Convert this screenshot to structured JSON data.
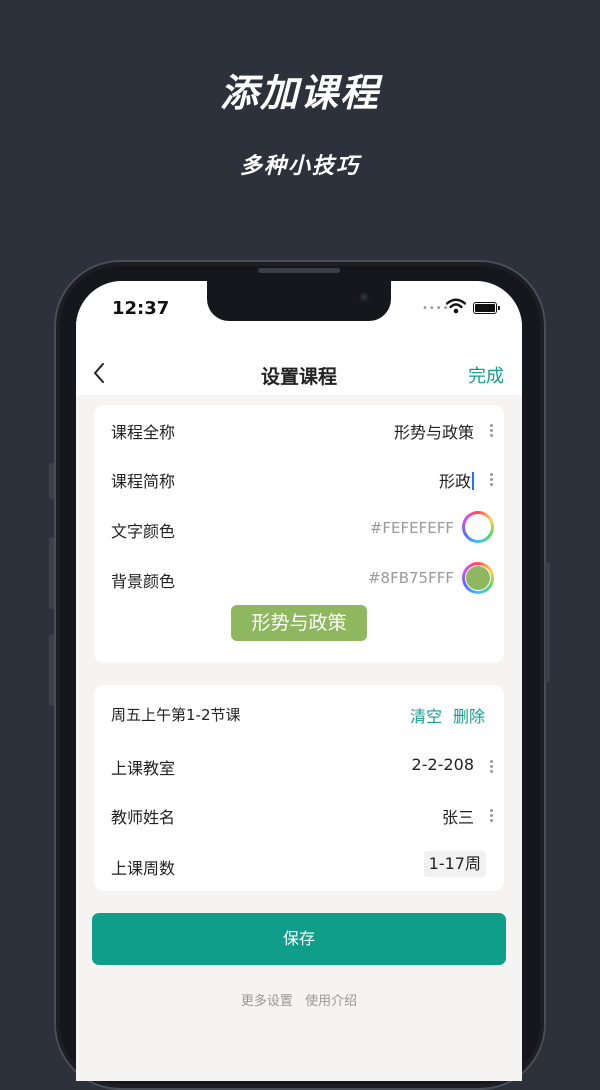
{
  "promo": {
    "title": "添加课程",
    "subtitle": "多种小技巧"
  },
  "status_bar": {
    "time": "12:37"
  },
  "nav": {
    "back_icon": "chevron-left-icon",
    "title": "设置课程",
    "done_label": "完成"
  },
  "course_info": {
    "full_name_label": "课程全称",
    "full_name_value": "形势与政策",
    "short_name_label": "课程简称",
    "short_name_value": "形政",
    "text_color_label": "文字颜色",
    "text_color_value": "#FEFEFEFF",
    "bg_color_label": "背景颜色",
    "bg_color_value": "#8FB75FFF",
    "preview_text": "形势与政策"
  },
  "session": {
    "title": "周五上午第1-2节课",
    "clear_label": "清空",
    "delete_label": "删除",
    "classroom_label": "上课教室",
    "classroom_value": "2-2-208",
    "teacher_label": "教师姓名",
    "teacher_value": "张三",
    "weeks_label": "上课周数",
    "weeks_value": "1-17周"
  },
  "save_label": "保存",
  "footer": {
    "more_settings": "更多设置",
    "usage_intro": "使用介绍"
  },
  "colors": {
    "accent": "#13a08d",
    "preview_bg": "#8FB75F",
    "preview_text": "#FEFEFE",
    "background": "#2d313b"
  }
}
